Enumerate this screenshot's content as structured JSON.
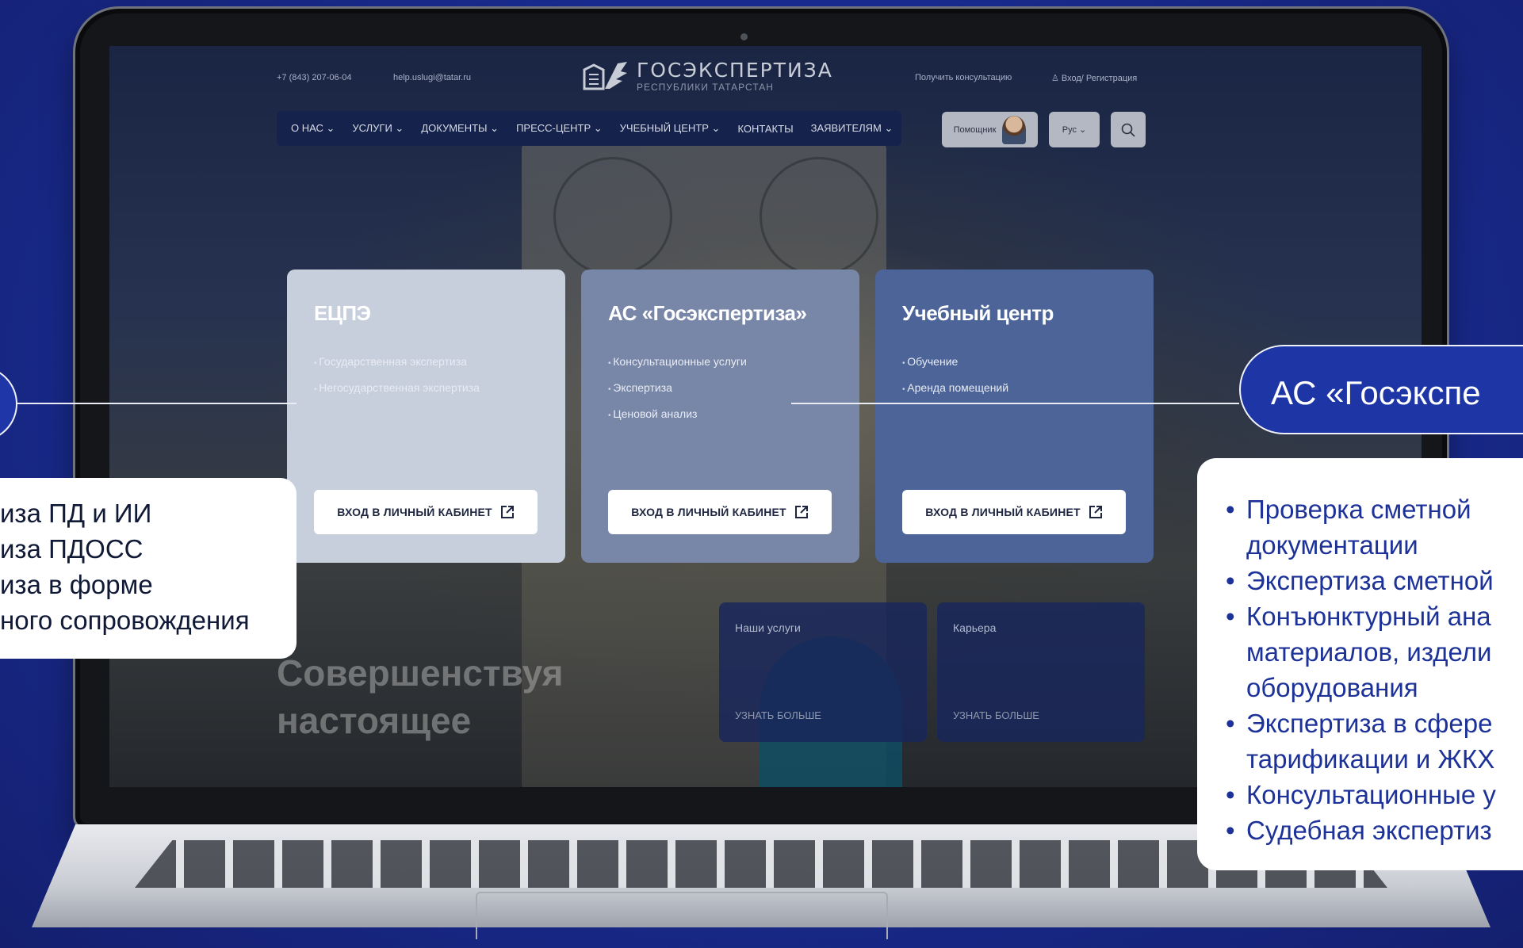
{
  "header": {
    "phone": "+7 (843) 207-06-04",
    "email": "help.uslugi@tatar.ru",
    "logo_title": "ГОСЭКСПЕРТИЗА",
    "logo_subtitle": "РЕСПУБЛИКИ ТАТАРСТАН",
    "consult_link": "Получить консультацию",
    "login_link": "Вход/ Регистрация",
    "assistant_label": "Помощник",
    "language": "Рус"
  },
  "nav": {
    "items": [
      {
        "label": "О НАС"
      },
      {
        "label": "УСЛУГИ"
      },
      {
        "label": "ДОКУМЕНТЫ"
      },
      {
        "label": "ПРЕСС-ЦЕНТР"
      },
      {
        "label": "УЧЕБНЫЙ ЦЕНТР"
      },
      {
        "label": "КОНТАКТЫ"
      },
      {
        "label": "ЗАЯВИТЕЛЯМ"
      }
    ]
  },
  "cards": [
    {
      "title": "ЕЦПЭ",
      "items": [
        "Государственная экспертиза",
        "Негосударственная экспертиза"
      ],
      "button": "ВХОД В ЛИЧНЫЙ КАБИНЕТ",
      "bg": "#c7cedc"
    },
    {
      "title": "АС «Госэкспертиза»",
      "items": [
        "Консультационные услуги",
        "Экспертиза",
        "Ценовой анализ"
      ],
      "button": "ВХОД В ЛИЧНЫЙ КАБИНЕТ",
      "bg": "#7886a8"
    },
    {
      "title": "Учебный центр",
      "items": [
        "Обучение",
        "Аренда помещений"
      ],
      "button": "ВХОД В ЛИЧНЫЙ КАБИНЕТ",
      "bg": "#4d6499"
    }
  ],
  "small_cards": [
    {
      "title": "Наши услуги",
      "more": "УЗНАТЬ БОЛЬШЕ"
    },
    {
      "title": "Карьера",
      "more": "УЗНАТЬ БОЛЬШЕ"
    }
  ],
  "hero": {
    "line1": "Совершенствуя",
    "line2": "настоящее"
  },
  "callouts": {
    "left_lines": [
      "иза ПД и ИИ",
      "иза ПДОСС",
      "иза в форме",
      "ного сопровождения"
    ],
    "right_title": "АС «Госэкспе",
    "right_items": [
      "Проверка сметной\nдокументации",
      "Экспертиза сметной",
      "Конъюнктурный ана\nматериалов, издели\nоборудования",
      "Экспертиза в сфере\nтарификации и ЖКХ",
      "Консультационные у",
      "Судебная экспертиз"
    ]
  },
  "colors": {
    "background": "#1a2d95",
    "navbar": "#15224c",
    "callout_text": "#1d3298"
  }
}
